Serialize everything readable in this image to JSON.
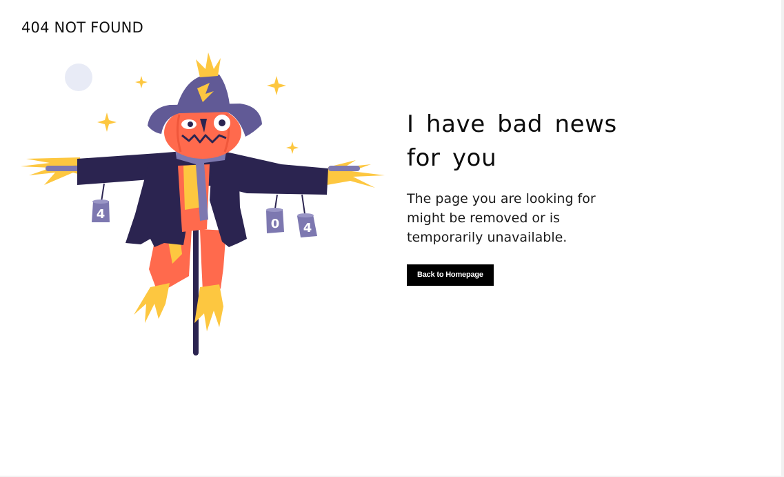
{
  "header": {
    "title": "404 NOT FOUND"
  },
  "illustration": {
    "icon": "scarecrow-illustration",
    "cans": [
      "4",
      "0",
      "4"
    ]
  },
  "main": {
    "headline": "I have bad news for you",
    "message": "The page you are looking for might be removed or is temporarily unavailable.",
    "button_label": "Back to Homepage"
  },
  "colors": {
    "text": "#0c0c0c",
    "button_bg": "#000000",
    "button_text": "#ffffff",
    "hat": "#615a96",
    "coat": "#2b2450",
    "pumpkin": "#ff6a4d",
    "straw": "#fdc740",
    "can": "#7d78b0"
  }
}
